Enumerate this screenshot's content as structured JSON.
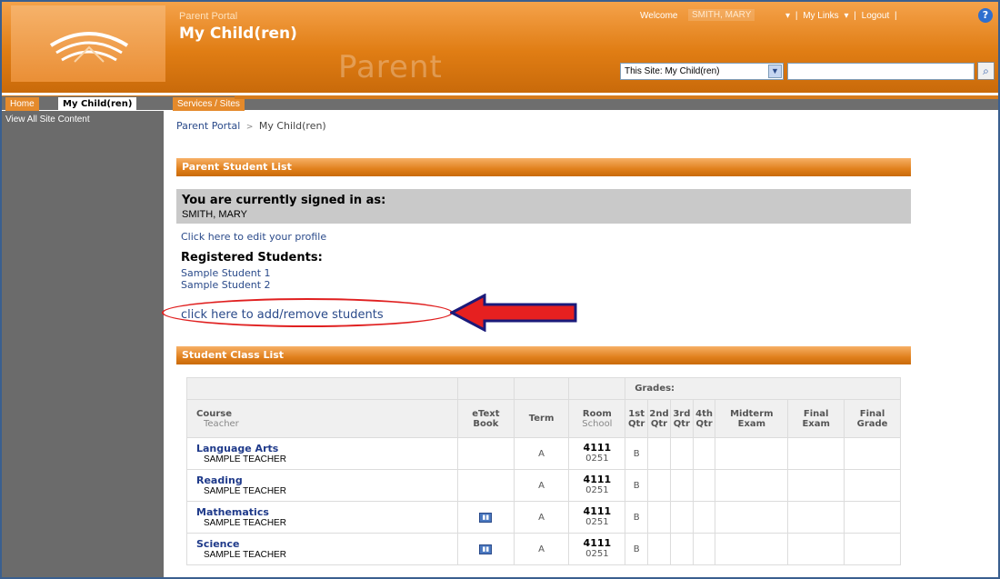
{
  "header": {
    "portal_small": "Parent Portal",
    "portal_title": "My Child(ren)",
    "watermark": "Parent",
    "welcome_label": "Welcome",
    "welcome_name": "SMITH, MARY",
    "links": [
      "My Links",
      "Logout"
    ],
    "site_select_value": "This Site: My Child(ren)",
    "search_value": ""
  },
  "nav": {
    "tabs": [
      "Home",
      "My Child(ren)",
      "Services / Sites"
    ],
    "active_tab": "My Child(ren)"
  },
  "sidebar": {
    "items": [
      "View All Site Content"
    ]
  },
  "breadcrumb": {
    "root": "Parent Portal",
    "separator": ">",
    "current": "My Child(ren)"
  },
  "student_list": {
    "title": "Parent Student List",
    "signed_in_label": "You are currently signed in as:",
    "signed_in_name": "SMITH, MARY",
    "edit_profile": "Click here to edit your profile",
    "registered_label": "Registered Students:",
    "students": [
      "Sample Student 1",
      "Sample Student 2"
    ],
    "add_remove": "click here to add/remove students"
  },
  "class_list": {
    "title": "Student Class List",
    "grades_label": "Grades:",
    "headers": {
      "course": "Course",
      "teacher": "Teacher",
      "etext": "eText Book",
      "term": "Term",
      "room": "Room",
      "school": "School",
      "q1": "1st Qtr",
      "q2": "2nd Qtr",
      "q3": "3rd Qtr",
      "q4": "4th Qtr",
      "midterm": "Midterm Exam",
      "final_exam": "Final Exam",
      "final_grade": "Final Grade"
    },
    "rows": [
      {
        "course": "Language Arts",
        "teacher": "SAMPLE TEACHER",
        "etext": false,
        "term": "A",
        "room": "4111",
        "school": "0251",
        "q1": "B"
      },
      {
        "course": "Reading",
        "teacher": "SAMPLE TEACHER",
        "etext": false,
        "term": "A",
        "room": "4111",
        "school": "0251",
        "q1": "B"
      },
      {
        "course": "Mathematics",
        "teacher": "SAMPLE TEACHER",
        "etext": true,
        "term": "A",
        "room": "4111",
        "school": "0251",
        "q1": "B"
      },
      {
        "course": "Science",
        "teacher": "SAMPLE TEACHER",
        "etext": true,
        "term": "A",
        "room": "4111",
        "school": "0251",
        "q1": "B"
      }
    ]
  },
  "icons": {
    "help": "help-icon",
    "search": "search-icon",
    "book": "book-icon",
    "logo": "logo-icon",
    "arrow": "arrow-left-icon"
  },
  "colors": {
    "header_orange": "#e07d14",
    "nav_gray": "#6e6e6e",
    "link_blue": "#2a4a8a",
    "annotation_red": "#e02020"
  }
}
